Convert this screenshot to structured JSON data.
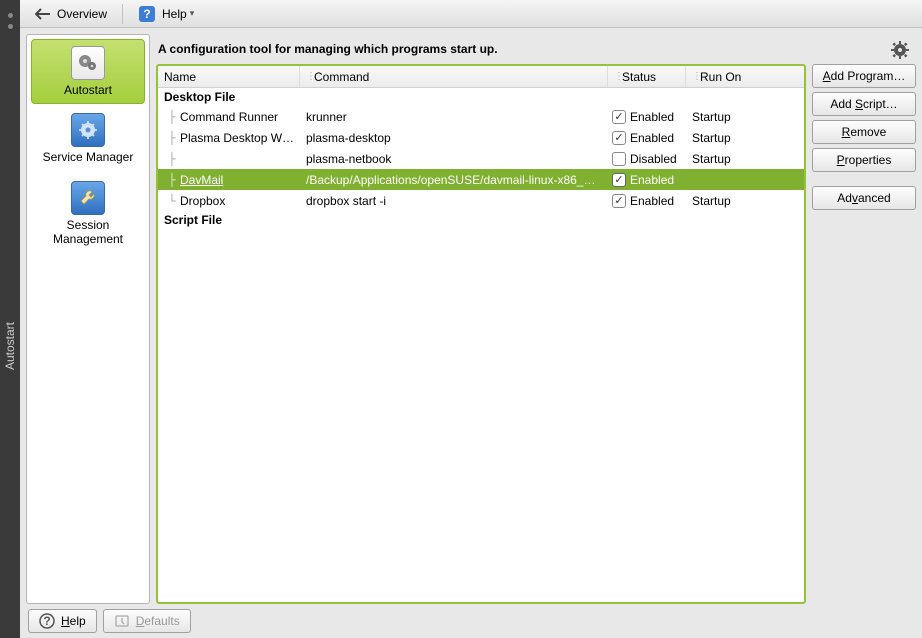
{
  "rail_label": "Autostart",
  "toolbar": {
    "overview": "Overview",
    "help": "Help"
  },
  "sidebar": {
    "autostart": "Autostart",
    "service_manager": "Service Manager",
    "session_management": "Session\nManagement"
  },
  "description": "A configuration tool for managing which programs start up.",
  "columns": {
    "name": "Name",
    "command": "Command",
    "status": "Status",
    "run_on": "Run On"
  },
  "groups": {
    "desktop_file": "Desktop File",
    "script_file": "Script File"
  },
  "rows": [
    {
      "name": "Command Runner",
      "command": "krunner",
      "enabled": true,
      "status": "Enabled",
      "run_on": "Startup"
    },
    {
      "name": "Plasma Desktop W…",
      "command": "plasma-desktop",
      "enabled": true,
      "status": "Enabled",
      "run_on": "Startup"
    },
    {
      "name": "",
      "command": "plasma-netbook",
      "enabled": false,
      "status": "Disabled",
      "run_on": "Startup"
    },
    {
      "name": "DavMail",
      "command": "/Backup/Applications/openSUSE/davmail-linux-x86_6…",
      "enabled": true,
      "status": "Enabled",
      "run_on": "",
      "selected": true
    },
    {
      "name": "Dropbox",
      "command": "dropbox start -i",
      "enabled": true,
      "status": "Enabled",
      "run_on": "Startup"
    }
  ],
  "buttons": {
    "add_program": [
      "A",
      "dd Program…"
    ],
    "add_script": [
      "Add ",
      "S",
      "cript…"
    ],
    "remove": [
      "R",
      "emove"
    ],
    "properties": [
      "P",
      "roperties"
    ],
    "advanced": [
      "Ad",
      "v",
      "anced"
    ]
  },
  "footer": {
    "help": [
      "H",
      "elp"
    ],
    "defaults": [
      "D",
      "efaults"
    ]
  }
}
